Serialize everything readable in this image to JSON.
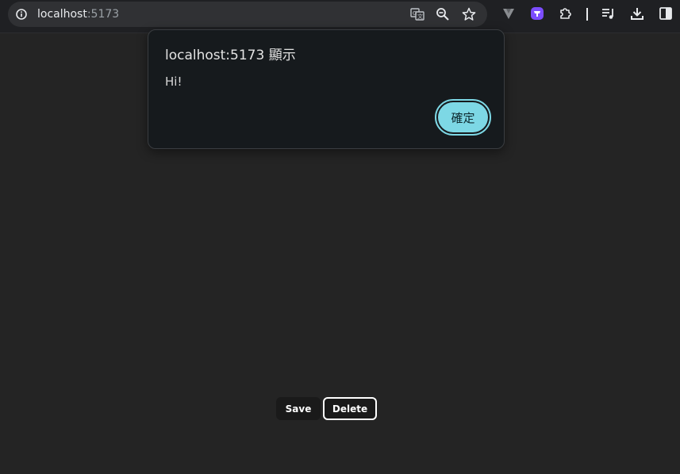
{
  "browser": {
    "url_host": "localhost",
    "url_port": ":5173",
    "omnibox_icons": [
      "translate-icon",
      "zoom-icon",
      "bookmark-star-icon"
    ],
    "toolbar_icons": [
      "vivaldi-icon",
      "extension-badge-icon",
      "extensions-puzzle-icon",
      "media-queue-icon",
      "download-icon",
      "side-panel-icon"
    ],
    "accent": "#7c4dff"
  },
  "dialog": {
    "title": "localhost:5173 顯示",
    "message": "Hi!",
    "ok_label": "確定",
    "ok_color": "#7dd8e5"
  },
  "page": {
    "save_label": "Save",
    "delete_label": "Delete"
  }
}
